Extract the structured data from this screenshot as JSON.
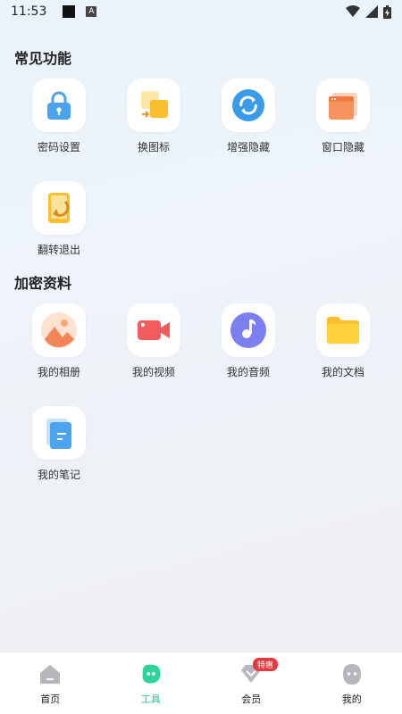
{
  "status": {
    "time": "11:53",
    "notif_letter": "A"
  },
  "sections": [
    {
      "title": "常见功能",
      "items": [
        {
          "label": "密码设置",
          "icon": "lock-icon"
        },
        {
          "label": "换图标",
          "icon": "swap-icon"
        },
        {
          "label": "增强隐藏",
          "icon": "sync-icon"
        },
        {
          "label": "窗口隐藏",
          "icon": "window-icon"
        },
        {
          "label": "翻转退出",
          "icon": "flip-phone-icon"
        }
      ]
    },
    {
      "title": "加密资料",
      "items": [
        {
          "label": "我的相册",
          "icon": "album-icon"
        },
        {
          "label": "我的视频",
          "icon": "video-icon"
        },
        {
          "label": "我的音频",
          "icon": "audio-icon"
        },
        {
          "label": "我的文档",
          "icon": "folder-icon"
        },
        {
          "label": "我的笔记",
          "icon": "note-icon"
        }
      ]
    }
  ],
  "nav": {
    "items": [
      {
        "label": "首页",
        "icon": "home-icon",
        "active": false
      },
      {
        "label": "工具",
        "icon": "tools-icon",
        "active": true
      },
      {
        "label": "会员",
        "icon": "vip-icon",
        "active": false
      },
      {
        "label": "我的",
        "icon": "profile-icon",
        "active": false
      }
    ],
    "badge": "特惠"
  },
  "colors": {
    "accent": "#27c48a",
    "badge": "#e8373e"
  }
}
